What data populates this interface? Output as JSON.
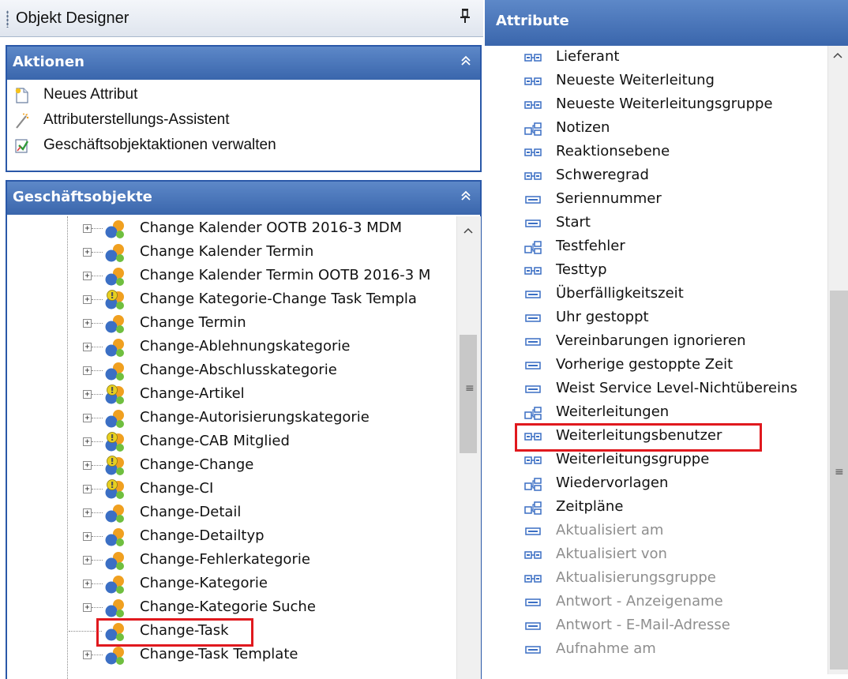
{
  "designer": {
    "title": "Objekt Designer",
    "pin": "⊥"
  },
  "aktionen": {
    "title": "Aktionen",
    "collapse": "⌃",
    "items": [
      {
        "label": "Neues Attribut",
        "icon": "new-attribute-icon"
      },
      {
        "label": "Attributerstellungs-Assistent",
        "icon": "wizard-wand-icon"
      },
      {
        "label": "Geschäftsobjektaktionen verwalten",
        "icon": "manage-actions-icon"
      }
    ]
  },
  "geschaeftsobjekte": {
    "title": "Geschäftsobjekte",
    "collapse": "⌃",
    "items": [
      {
        "label": "Change Kalender OOTB 2016-3 MDM",
        "icon": "business-object-icon",
        "expander": "+"
      },
      {
        "label": "Change Kalender Termin",
        "icon": "business-object-icon",
        "expander": "+"
      },
      {
        "label": "Change Kalender Termin OOTB 2016-3 M",
        "icon": "business-object-icon",
        "expander": "+"
      },
      {
        "label": "Change Kategorie-Change Task Templa",
        "icon": "business-object-link-icon",
        "expander": "+"
      },
      {
        "label": "Change Termin",
        "icon": "business-object-icon",
        "expander": "+"
      },
      {
        "label": "Change-Ablehnungskategorie",
        "icon": "business-object-icon",
        "expander": "+"
      },
      {
        "label": "Change-Abschlusskategorie",
        "icon": "business-object-icon",
        "expander": "+"
      },
      {
        "label": "Change-Artikel",
        "icon": "business-object-link-icon",
        "expander": "+"
      },
      {
        "label": "Change-Autorisierungskategorie",
        "icon": "business-object-icon",
        "expander": "+"
      },
      {
        "label": "Change-CAB Mitglied",
        "icon": "business-object-link-icon",
        "expander": "+"
      },
      {
        "label": "Change-Change",
        "icon": "business-object-link-icon",
        "expander": "+"
      },
      {
        "label": "Change-CI",
        "icon": "business-object-link-icon",
        "expander": "+"
      },
      {
        "label": "Change-Detail",
        "icon": "business-object-icon",
        "expander": "+"
      },
      {
        "label": "Change-Detailtyp",
        "icon": "business-object-icon",
        "expander": "+"
      },
      {
        "label": "Change-Fehlerkategorie",
        "icon": "business-object-icon",
        "expander": "+"
      },
      {
        "label": "Change-Kategorie",
        "icon": "business-object-icon",
        "expander": "+"
      },
      {
        "label": "Change-Kategorie Suche",
        "icon": "business-object-icon",
        "expander": "+"
      },
      {
        "label": "Change-Task",
        "icon": "business-object-icon",
        "expander": "",
        "highlighted": true
      },
      {
        "label": "Change-Task Template",
        "icon": "business-object-icon",
        "expander": "+"
      }
    ],
    "scroll": {
      "up": "⌃",
      "grip": "≡"
    }
  },
  "attribute": {
    "title": "Attribute",
    "items": [
      {
        "label": "Lieferant",
        "icon": "relation-attribute-icon",
        "inherited": false
      },
      {
        "label": "Neueste Weiterleitung",
        "icon": "relation-attribute-icon",
        "inherited": false
      },
      {
        "label": "Neueste Weiterleitungsgruppe",
        "icon": "relation-attribute-icon",
        "inherited": false
      },
      {
        "label": "Notizen",
        "icon": "collection-attribute-icon",
        "inherited": false
      },
      {
        "label": "Reaktionsebene",
        "icon": "relation-attribute-icon",
        "inherited": false
      },
      {
        "label": "Schweregrad",
        "icon": "relation-attribute-icon",
        "inherited": false
      },
      {
        "label": "Seriennummer",
        "icon": "field-attribute-icon",
        "inherited": false
      },
      {
        "label": "Start",
        "icon": "field-attribute-icon",
        "inherited": false
      },
      {
        "label": "Testfehler",
        "icon": "collection-attribute-icon",
        "inherited": false
      },
      {
        "label": "Testtyp",
        "icon": "relation-attribute-icon",
        "inherited": false
      },
      {
        "label": "Überfälligkeitszeit",
        "icon": "field-attribute-icon",
        "inherited": false
      },
      {
        "label": "Uhr gestoppt",
        "icon": "field-attribute-icon",
        "inherited": false
      },
      {
        "label": "Vereinbarungen ignorieren",
        "icon": "field-attribute-icon",
        "inherited": false
      },
      {
        "label": "Vorherige gestoppte Zeit",
        "icon": "field-attribute-icon",
        "inherited": false
      },
      {
        "label": "Weist Service Level-Nichtübereins",
        "icon": "field-attribute-icon",
        "inherited": false
      },
      {
        "label": "Weiterleitungen",
        "icon": "collection-attribute-icon",
        "inherited": false
      },
      {
        "label": "Weiterleitungsbenutzer",
        "icon": "relation-attribute-icon",
        "inherited": false,
        "highlighted": true
      },
      {
        "label": "Weiterleitungsgruppe",
        "icon": "relation-attribute-icon",
        "inherited": false
      },
      {
        "label": "Wiedervorlagen",
        "icon": "collection-attribute-icon",
        "inherited": false
      },
      {
        "label": "Zeitpläne",
        "icon": "collection-attribute-icon",
        "inherited": false
      },
      {
        "label": "Aktualisiert am",
        "icon": "field-attribute-icon",
        "inherited": true
      },
      {
        "label": "Aktualisiert von",
        "icon": "relation-attribute-icon",
        "inherited": true
      },
      {
        "label": "Aktualisierungsgruppe",
        "icon": "relation-attribute-icon",
        "inherited": true
      },
      {
        "label": "Antwort - Anzeigename",
        "icon": "field-attribute-icon",
        "inherited": true
      },
      {
        "label": "Antwort - E-Mail-Adresse",
        "icon": "field-attribute-icon",
        "inherited": true
      },
      {
        "label": "Aufnahme am",
        "icon": "field-attribute-icon",
        "inherited": true
      }
    ],
    "scroll": {
      "up": "⌃",
      "grip": "≡"
    }
  },
  "colors": {
    "header_blue": "#3a66ac",
    "highlight_red": "#e0191e",
    "inherited_text": "#8e8e8e",
    "icon_blue": "#3b6fc4",
    "icon_orange": "#f0a020",
    "icon_yellow": "#e8d020"
  }
}
